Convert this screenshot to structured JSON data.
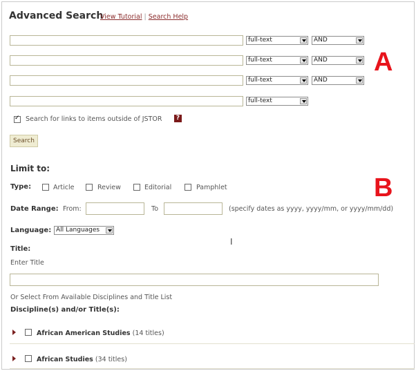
{
  "header": {
    "title": "Advanced Search",
    "view_tutorial": "View Tutorial",
    "separator": "|",
    "search_help": "Search Help"
  },
  "search_rows": [
    {
      "field": "full-text",
      "operator": "AND"
    },
    {
      "field": "full-text",
      "operator": "AND"
    },
    {
      "field": "full-text",
      "operator": "AND"
    },
    {
      "field": "full-text"
    }
  ],
  "outside_links": {
    "label": "Search for links to items outside of JSTOR",
    "checked": true,
    "help_glyph": "?"
  },
  "search_button": "Search",
  "annotations": {
    "a": "A",
    "b": "B"
  },
  "limit": {
    "heading": "Limit to:",
    "type_label": "Type:",
    "types": [
      "Article",
      "Review",
      "Editorial",
      "Pamphlet"
    ],
    "date_label": "Date Range:",
    "from_label": "From:",
    "to_label": "To",
    "date_hint": "(specify dates as yyyy, yyyy/mm, or yyyy/mm/dd)",
    "language_label": "Language:",
    "language_value": "All Languages"
  },
  "title_section": {
    "label": "Title:",
    "enter_title": "Enter Title",
    "or_select": "Or Select From Available Disciplines and Title List",
    "disciplines_label": "Discipline(s) and/or Title(s):"
  },
  "disciplines": [
    {
      "name": "African American Studies",
      "count": "(14 titles)"
    },
    {
      "name": "African Studies",
      "count": "(34 titles)"
    }
  ],
  "text_cursor": "I",
  "colors": {
    "accent_link": "#8a2b2b",
    "annotation": "#e8141c",
    "button_bg": "#efecd2",
    "input_border": "#b8b596"
  }
}
